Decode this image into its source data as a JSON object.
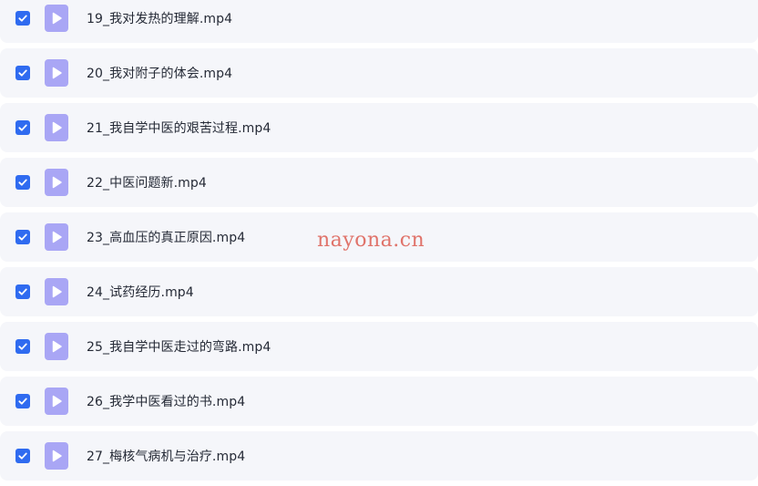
{
  "files": [
    {
      "name": "19_我对发热的理解.mp4",
      "checked": true,
      "icon": "video-file-icon"
    },
    {
      "name": "20_我对附子的体会.mp4",
      "checked": true,
      "icon": "video-file-icon"
    },
    {
      "name": "21_我自学中医的艰苦过程.mp4",
      "checked": true,
      "icon": "video-file-icon"
    },
    {
      "name": "22_中医问题新.mp4",
      "checked": true,
      "icon": "video-file-icon"
    },
    {
      "name": "23_高血压的真正原因.mp4",
      "checked": true,
      "icon": "video-file-icon"
    },
    {
      "name": "24_试药经历.mp4",
      "checked": true,
      "icon": "video-file-icon"
    },
    {
      "name": "25_我自学中医走过的弯路.mp4",
      "checked": true,
      "icon": "video-file-icon"
    },
    {
      "name": "26_我学中医看过的书.mp4",
      "checked": true,
      "icon": "video-file-icon"
    },
    {
      "name": "27_梅核气病机与治疗.mp4",
      "checked": true,
      "icon": "video-file-icon"
    }
  ],
  "watermark": "nayona.cn",
  "colors": {
    "row_background": "#f5f6fa",
    "checkbox": "#2f6bf0",
    "file_icon": "#a9a6f5",
    "text": "#252a36",
    "watermark": "#d9483b"
  }
}
